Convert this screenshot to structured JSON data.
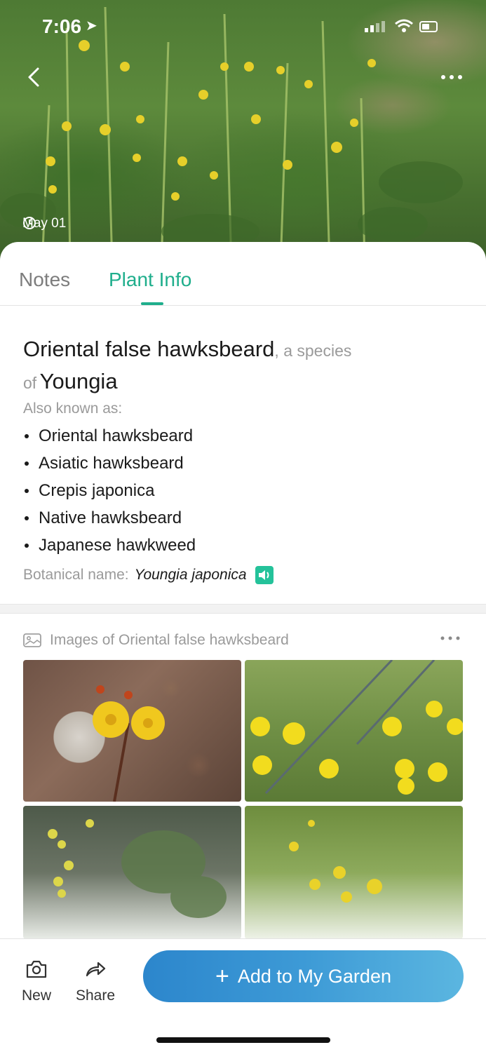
{
  "status_bar": {
    "time": "7:06"
  },
  "hero": {
    "date": "May 01"
  },
  "tabs": [
    {
      "label": "Notes"
    },
    {
      "label": "Plant Info"
    }
  ],
  "plant": {
    "common_name": "Oriental false hawksbeard",
    "species_of_prefix": ", a species",
    "of_word": "of",
    "genus": "Youngia",
    "aka_label": "Also known as:",
    "aka": [
      "Oriental hawksbeard",
      "Asiatic hawksbeard",
      "Crepis japonica",
      "Native hawksbeard",
      "Japanese hawkweed"
    ],
    "botanical_label": "Botanical name:",
    "botanical_name": "Youngia japonica"
  },
  "images": {
    "title": "Images of Oriental false hawksbeard"
  },
  "bottom_bar": {
    "new_label": "New",
    "share_label": "Share",
    "add_label": "Add to My Garden"
  },
  "colors": {
    "accent": "#1fae8c",
    "button": "#2c86cc",
    "speaker": "#24c29a"
  }
}
